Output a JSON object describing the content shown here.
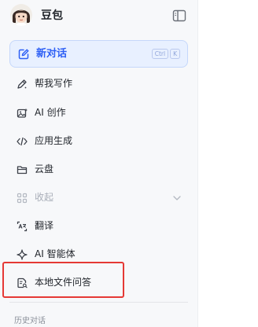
{
  "app": {
    "name": "豆包"
  },
  "new_chat": {
    "label": "新对话",
    "shortcut": [
      "Ctrl",
      "K"
    ]
  },
  "nav_items": [
    {
      "label": "帮我写作",
      "icon": "pen-write-icon"
    },
    {
      "label": "AI 创作",
      "icon": "image-create-icon"
    },
    {
      "label": "应用生成",
      "icon": "code-brackets-icon"
    },
    {
      "label": "云盘",
      "icon": "cloud-folder-icon"
    },
    {
      "label": "收起",
      "icon": "apps-grid-icon",
      "muted": true,
      "chevron": "chevron-down-icon"
    },
    {
      "label": "翻译",
      "icon": "translate-icon"
    },
    {
      "label": "AI 智能体",
      "icon": "sparkle-icon"
    },
    {
      "label": "本地文件问答",
      "icon": "file-search-icon"
    }
  ],
  "history": {
    "heading": "历史对话"
  },
  "colors": {
    "accent": "#2d5ff5",
    "highlight_border": "#e53935",
    "sidebar_bg": "#f7f8fa"
  }
}
